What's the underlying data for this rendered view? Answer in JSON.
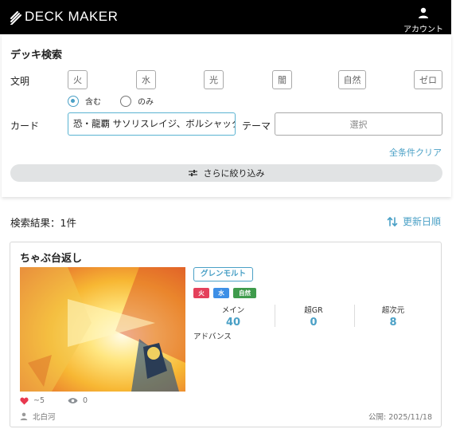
{
  "header": {
    "logo_text": "DECK MAKER",
    "account_label": "アカウント",
    "account_icon": "user-icon"
  },
  "search": {
    "title": "デッキ検索",
    "civilization_label": "文明",
    "civilizations": [
      "火",
      "水",
      "光",
      "闇",
      "自然",
      "ゼロ"
    ],
    "match_options": [
      "含む",
      "のみ"
    ],
    "match_selected": "含む",
    "card_label": "カード",
    "card_value": "恐・龍覇 サソリスレイジ、ボルシャック",
    "theme_label": "テーマ",
    "theme_placeholder": "選択",
    "clear_all": "全条件クリア",
    "narrow_down": "さらに絞り込み",
    "narrow_icon": "sliders-icon"
  },
  "results": {
    "summary": "検索結果：1件",
    "sort_label": "更新日順",
    "sort_icon": "sort-icon",
    "items": [
      {
        "name": "ちゃぶ台返し",
        "tag": "グレンモルト",
        "civs": [
          {
            "label": "火",
            "color": "#e4405b"
          },
          {
            "label": "水",
            "color": "#3d8fe6"
          },
          {
            "label": "自然",
            "color": "#3f9b4c"
          }
        ],
        "stats": [
          {
            "label": "メイン",
            "value": "40"
          },
          {
            "label": "超GR",
            "value": "0"
          },
          {
            "label": "超次元",
            "value": "8"
          }
        ],
        "deck_type": "アドバンス",
        "likes": "~5",
        "views": "0",
        "author": "北白河",
        "published": "公開: 2025/11/18"
      }
    ]
  },
  "colors": {
    "accent": "#4aa0c6",
    "header_bg": "#000000",
    "heart": "#e8384f"
  }
}
